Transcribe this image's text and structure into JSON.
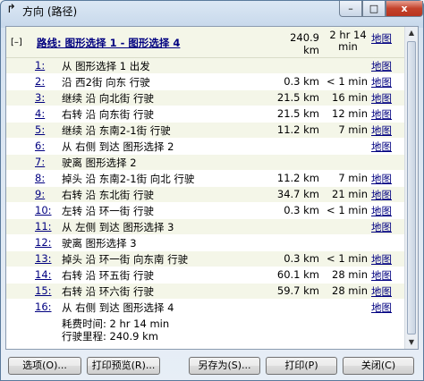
{
  "window": {
    "title": "方向 (路径)",
    "min_label": "–",
    "max_label": "□",
    "close_label": "x"
  },
  "route": {
    "collapse": "[–]",
    "label": "路线: 图形选择 1 - 图形选择 4",
    "distance": "240.9 km",
    "time_line1": "2 hr 14",
    "time_line2": "min",
    "map_link": "地图"
  },
  "steps": [
    {
      "num": "1:",
      "text": "从 图形选择 1 出发",
      "distance": "",
      "time": "",
      "map": "地图"
    },
    {
      "num": "2:",
      "text": "沿 西2街 向东 行驶",
      "distance": "0.3 km",
      "time": "< 1 min",
      "map": "地图"
    },
    {
      "num": "3:",
      "text": "继续 沿 向北街 行驶",
      "distance": "21.5 km",
      "time": "16 min",
      "map": "地图"
    },
    {
      "num": "4:",
      "text": "右转 沿 向东街 行驶",
      "distance": "21.5 km",
      "time": "12 min",
      "map": "地图"
    },
    {
      "num": "5:",
      "text": "继续 沿 东南2-1街 行驶",
      "distance": "11.2 km",
      "time": "7 min",
      "map": "地图"
    },
    {
      "num": "6:",
      "text": "从 右侧 到达 图形选择 2",
      "distance": "",
      "time": "",
      "map": "地图"
    },
    {
      "num": "7:",
      "text": "驶离 图形选择 2",
      "distance": "",
      "time": "",
      "map": ""
    },
    {
      "num": "8:",
      "text": "掉头 沿 东南2-1街 向北 行驶",
      "distance": "11.2 km",
      "time": "7 min",
      "map": "地图"
    },
    {
      "num": "9:",
      "text": "右转 沿 东北街 行驶",
      "distance": "34.7 km",
      "time": "21 min",
      "map": "地图"
    },
    {
      "num": "10:",
      "text": "左转 沿 环一街 行驶",
      "distance": "0.3 km",
      "time": "< 1 min",
      "map": "地图"
    },
    {
      "num": "11:",
      "text": "从 左侧 到达 图形选择 3",
      "distance": "",
      "time": "",
      "map": "地图"
    },
    {
      "num": "12:",
      "text": "驶离 图形选择 3",
      "distance": "",
      "time": "",
      "map": ""
    },
    {
      "num": "13:",
      "text": "掉头 沿 环一街 向东南 行驶",
      "distance": "0.3 km",
      "time": "< 1 min",
      "map": "地图"
    },
    {
      "num": "14:",
      "text": "右转 沿 环五街 行驶",
      "distance": "60.1 km",
      "time": "28 min",
      "map": "地图"
    },
    {
      "num": "15:",
      "text": "右转 沿 环六街 行驶",
      "distance": "59.7 km",
      "time": "28 min",
      "map": "地图"
    },
    {
      "num": "16:",
      "text": "从 右侧 到达 图形选择 4",
      "distance": "",
      "time": "",
      "map": "地图"
    }
  ],
  "summary": {
    "total_time": "耗费时间: 2 hr 14 min",
    "total_distance": "行驶里程: 240.9 km"
  },
  "buttons": {
    "options": "选项(O)...",
    "print_preview": "打印预览(R)...",
    "save_as": "另存为(S)...",
    "print": "打印(P)",
    "close": "关闭(C)"
  }
}
